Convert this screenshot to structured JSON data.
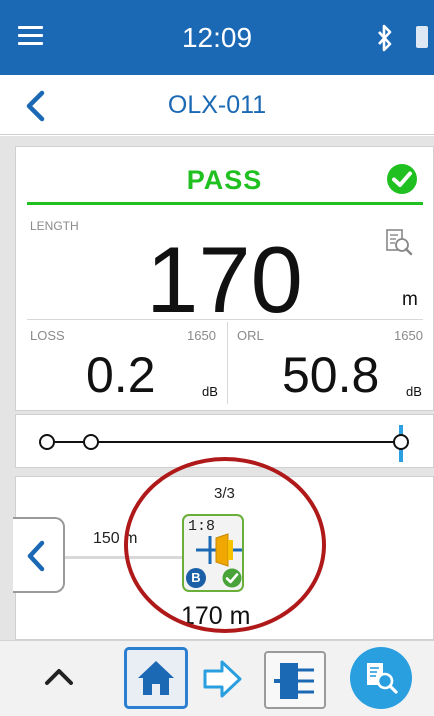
{
  "status_bar": {
    "time": "12:09",
    "color": "#1b68b5"
  },
  "nav": {
    "title": "OLX-011"
  },
  "result": {
    "verdict": "PASS",
    "verdict_color": "#21c021",
    "length_label": "LENGTH",
    "length_value": "170",
    "length_unit": "m",
    "loss_label": "LOSS",
    "loss_wavelength": "1650",
    "loss_value": "0.2",
    "loss_unit": "dB",
    "orl_label": "ORL",
    "orl_wavelength": "1650",
    "orl_value": "50.8",
    "orl_unit": "dB"
  },
  "map": {
    "counter": "3/3",
    "link_distance": "150 m",
    "splitter_ratio": "1:8",
    "badge_letter": "B",
    "element_distance": "170 m"
  },
  "icons": {
    "menu": "menu-icon",
    "bluetooth": "bluetooth-icon",
    "battery": "battery-icon",
    "back": "chevron-left-icon",
    "pass": "check-circle-icon",
    "report": "report-magnifier-icon",
    "prev": "chevron-left-icon",
    "up": "chevron-up-icon",
    "home": "home-icon",
    "arrow": "arrow-right-icon",
    "splitter": "splitter-icon",
    "fab": "report-magnifier-icon"
  }
}
